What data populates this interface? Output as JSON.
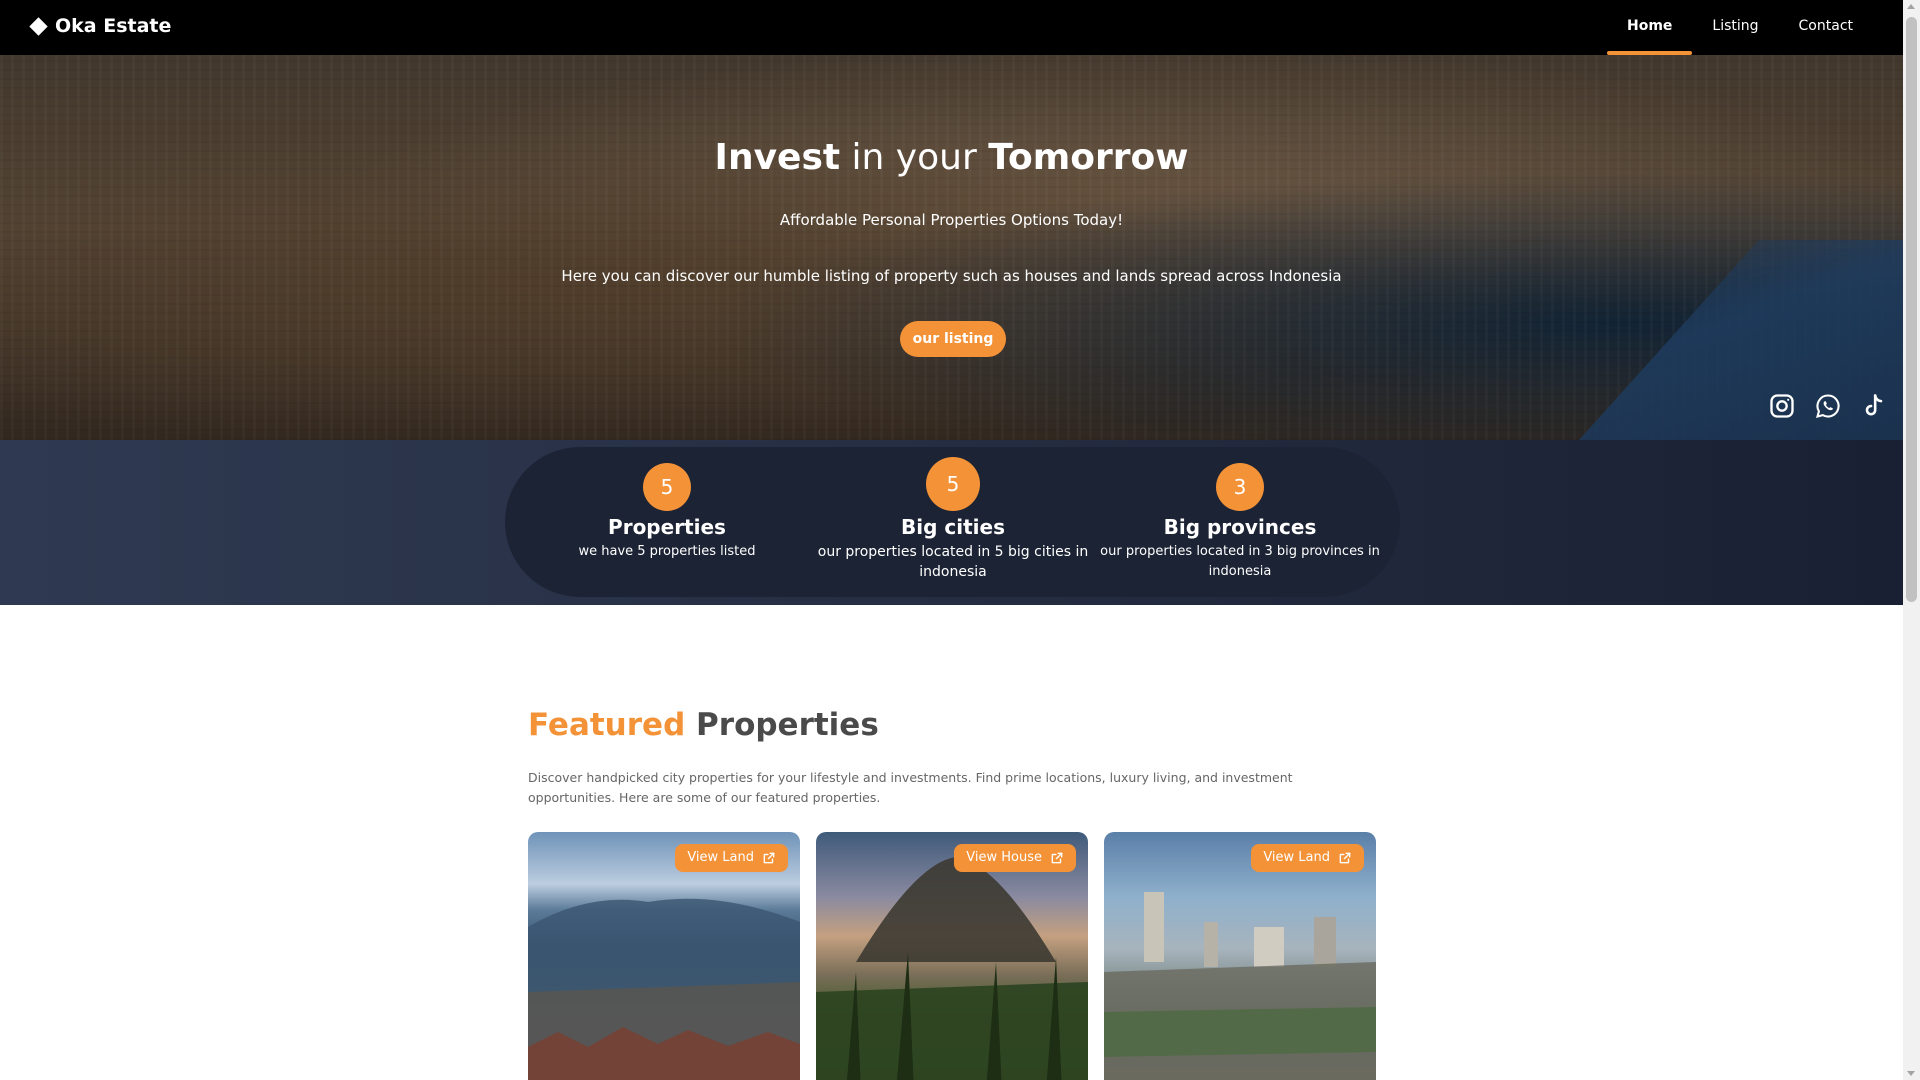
{
  "brand": {
    "name": "Oka Estate",
    "icon": "diamond-icon"
  },
  "nav": {
    "items": [
      {
        "label": "Home",
        "active": true
      },
      {
        "label": "Listing",
        "active": false
      },
      {
        "label": "Contact",
        "active": false
      }
    ]
  },
  "hero": {
    "title_part1": "Invest",
    "title_part2": " in your ",
    "title_part3": "Tomorrow",
    "subtitle": "Affordable Personal Properties Options Today!",
    "description": "Here you can discover our humble listing of property such as houses and lands spread across Indonesia",
    "button_label": "our listing",
    "socials": [
      "instagram-icon",
      "whatsapp-icon",
      "tiktok-icon"
    ]
  },
  "stats": [
    {
      "number": "5",
      "title": "Properties",
      "desc": "we have 5 properties listed"
    },
    {
      "number": "5",
      "title": "Big cities",
      "desc": "our properties located in 5 big cities in indonesia"
    },
    {
      "number": "3",
      "title": "Big provinces",
      "desc": "our properties located in 3 big provinces in indonesia"
    }
  ],
  "featured": {
    "title_accent": "Featured",
    "title_rest": " Properties",
    "description": "Discover handpicked city properties for your lifestyle and investments. Find prime locations, luxury living, and investment opportunities. Here are some of our featured properties.",
    "cards": [
      {
        "button_label": "View Land"
      },
      {
        "button_label": "View House"
      },
      {
        "button_label": "View Land"
      }
    ]
  },
  "colors": {
    "accent": "#f39237",
    "navbar": "#000000",
    "stats_band": "#252d42"
  }
}
